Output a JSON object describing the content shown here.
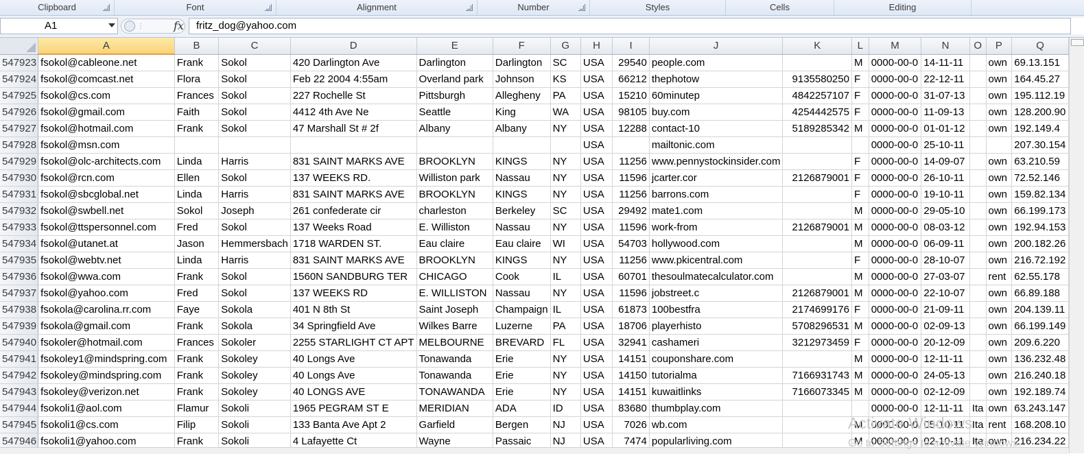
{
  "ribbon": {
    "groups": [
      "Clipboard",
      "Font",
      "Alignment",
      "Number",
      "Styles",
      "Cells",
      "Editing"
    ]
  },
  "formula_bar": {
    "name_box": "A1",
    "fx_label": "fx",
    "formula": "fritz_dog@yahoo.com"
  },
  "columns": [
    "A",
    "B",
    "C",
    "D",
    "E",
    "F",
    "G",
    "H",
    "I",
    "J",
    "K",
    "L",
    "M",
    "N",
    "O",
    "P",
    "Q"
  ],
  "selected_column": "A",
  "rows": [
    [
      "547923",
      "fsokol@cableone.net",
      "Frank",
      "Sokol",
      "420 Darlington Ave",
      "Darlington",
      "Darlington",
      "SC",
      "USA",
      "29540",
      "people.com",
      "",
      "M",
      "0000-00-0",
      "14-11-11",
      "",
      "own",
      "69.13.151"
    ],
    [
      "547924",
      "fsokol@comcast.net",
      "Flora",
      "Sokol",
      "Feb 22 2004 4:55am",
      "Overland park",
      "Johnson",
      "KS",
      "USA",
      "66212",
      "thephotow",
      "9135580250",
      "F",
      "0000-00-0",
      "22-12-11",
      "",
      "own",
      "164.45.27"
    ],
    [
      "547925",
      "fsokol@cs.com",
      "Frances",
      "Sokol",
      "227 Rochelle St",
      "Pittsburgh",
      "Allegheny",
      "PA",
      "USA",
      "15210",
      "60minutep",
      "4842257107",
      "F",
      "0000-00-0",
      "31-07-13",
      "",
      "own",
      "195.112.19"
    ],
    [
      "547926",
      "fsokol@gmail.com",
      "Faith",
      "Sokol",
      "4412 4th Ave Ne",
      "Seattle",
      "King",
      "WA",
      "USA",
      "98105",
      "buy.com",
      "4254442575",
      "F",
      "0000-00-0",
      "11-09-13",
      "",
      "own",
      "128.200.90"
    ],
    [
      "547927",
      "fsokol@hotmail.com",
      "Frank",
      "Sokol",
      "47 Marshall St # 2f",
      "Albany",
      "Albany",
      "NY",
      "USA",
      "12288",
      "contact-10",
      "5189285342",
      "M",
      "0000-00-0",
      "01-01-12",
      "",
      "own",
      "192.149.4"
    ],
    [
      "547928",
      "fsokol@msn.com",
      "",
      "",
      "",
      "",
      "",
      "",
      "USA",
      "",
      "mailtonic.com",
      "",
      "",
      "0000-00-0",
      "25-10-11",
      "",
      "",
      "207.30.154"
    ],
    [
      "547929",
      "fsokol@olc-architects.com",
      "Linda",
      "Harris",
      "831 SAINT MARKS AVE",
      "BROOKLYN",
      "KINGS",
      "NY",
      "USA",
      "11256",
      "www.pennystockinsider.com",
      "",
      "F",
      "0000-00-0",
      "14-09-07",
      "",
      "own",
      "63.210.59"
    ],
    [
      "547930",
      "fsokol@rcn.com",
      "Ellen",
      "Sokol",
      "137 WEEKS RD.",
      "Williston park",
      "Nassau",
      "NY",
      "USA",
      "11596",
      "jcarter.cor",
      "2126879001",
      "F",
      "0000-00-0",
      "26-10-11",
      "",
      "own",
      "72.52.146"
    ],
    [
      "547931",
      "fsokol@sbcglobal.net",
      "Linda",
      "Harris",
      "831 SAINT MARKS AVE",
      "BROOKLYN",
      "KINGS",
      "NY",
      "USA",
      "11256",
      "barrons.com",
      "",
      "F",
      "0000-00-0",
      "19-10-11",
      "",
      "own",
      "159.82.134"
    ],
    [
      "547932",
      "fsokol@swbell.net",
      "Sokol",
      "Joseph",
      "261 confederate cir",
      "charleston",
      "Berkeley",
      "SC",
      "USA",
      "29492",
      "mate1.com",
      "",
      "M",
      "0000-00-0",
      "29-05-10",
      "",
      "own",
      "66.199.173"
    ],
    [
      "547933",
      "fsokol@ttspersonnel.com",
      "Fred",
      "Sokol",
      "137 Weeks Road",
      "E. Williston",
      "Nassau",
      "NY",
      "USA",
      "11596",
      "work-from",
      "2126879001",
      "M",
      "0000-00-0",
      "08-03-12",
      "",
      "own",
      "192.94.153"
    ],
    [
      "547934",
      "fsokol@utanet.at",
      "Jason",
      "Hemmersbach",
      "1718 WARDEN ST.",
      "Eau claire",
      "Eau claire",
      "WI",
      "USA",
      "54703",
      "hollywood.com",
      "",
      "M",
      "0000-00-0",
      "06-09-11",
      "",
      "own",
      "200.182.26"
    ],
    [
      "547935",
      "fsokol@webtv.net",
      "Linda",
      "Harris",
      "831 SAINT MARKS AVE",
      "BROOKLYN",
      "KINGS",
      "NY",
      "USA",
      "11256",
      "www.pkicentral.com",
      "",
      "F",
      "0000-00-0",
      "28-10-07",
      "",
      "own",
      "216.72.192"
    ],
    [
      "547936",
      "fsokol@wwa.com",
      "Frank",
      "Sokol",
      "1560N SANDBURG TER",
      "CHICAGO",
      "Cook",
      "IL",
      "USA",
      "60701",
      "thesoulmatecalculator.com",
      "",
      "M",
      "0000-00-0",
      "27-03-07",
      "",
      "rent",
      "62.55.178"
    ],
    [
      "547937",
      "fsokol@yahoo.com",
      "Fred",
      "Sokol",
      "137 WEEKS RD",
      "E. WILLISTON",
      "Nassau",
      "NY",
      "USA",
      "11596",
      "jobstreet.c",
      "2126879001",
      "M",
      "0000-00-0",
      "22-10-07",
      "",
      "own",
      "66.89.188"
    ],
    [
      "547938",
      "fsokola@carolina.rr.com",
      "Faye",
      "Sokola",
      "401 N 8th St",
      "Saint Joseph",
      "Champaign",
      "IL",
      "USA",
      "61873",
      "100bestfra",
      "2174699176",
      "F",
      "0000-00-0",
      "21-09-11",
      "",
      "own",
      "204.139.11"
    ],
    [
      "547939",
      "fsokola@gmail.com",
      "Frank",
      "Sokola",
      "34 Springfield Ave",
      "Wilkes Barre",
      "Luzerne",
      "PA",
      "USA",
      "18706",
      "playerhisto",
      "5708296531",
      "M",
      "0000-00-0",
      "02-09-13",
      "",
      "own",
      "66.199.149"
    ],
    [
      "547940",
      "fsokoler@hotmail.com",
      "Frances",
      "Sokoler",
      "2255 STARLIGHT CT APT",
      "MELBOURNE",
      "BREVARD",
      "FL",
      "USA",
      "32941",
      "cashameri",
      "3212973459",
      "F",
      "0000-00-0",
      "20-12-09",
      "",
      "own",
      "209.6.220"
    ],
    [
      "547941",
      "fsokoley1@mindspring.com",
      "Frank",
      "Sokoley",
      "40 Longs Ave",
      "Tonawanda",
      "Erie",
      "NY",
      "USA",
      "14151",
      "couponshare.com",
      "",
      "M",
      "0000-00-0",
      "12-11-11",
      "",
      "own",
      "136.232.48"
    ],
    [
      "547942",
      "fsokoley@mindspring.com",
      "Frank",
      "Sokoley",
      "40 Longs Ave",
      "Tonawanda",
      "Erie",
      "NY",
      "USA",
      "14150",
      "tutorialma",
      "7166931743",
      "M",
      "0000-00-0",
      "24-05-13",
      "",
      "own",
      "216.240.18"
    ],
    [
      "547943",
      "fsokoley@verizon.net",
      "Frank",
      "Sokoley",
      "40 LONGS AVE",
      "TONAWANDA",
      "Erie",
      "NY",
      "USA",
      "14151",
      "kuwaitlinks",
      "7166073345",
      "M",
      "0000-00-0",
      "02-12-09",
      "",
      "own",
      "192.189.74"
    ],
    [
      "547944",
      "fsokoli1@aol.com",
      "Flamur",
      "Sokoli",
      "1965 PEGRAM ST E",
      "MERIDIAN",
      "ADA",
      "ID",
      "USA",
      "83680",
      "thumbplay.com",
      "",
      "",
      "0000-00-0",
      "12-11-11",
      "Ita",
      "own",
      "63.243.147"
    ],
    [
      "547945",
      "fsokoli1@cs.com",
      "Filip",
      "Sokoli",
      "133 Banta Ave Apt 2",
      "Garfield",
      "Bergen",
      "NJ",
      "USA",
      "7026",
      "wb.com",
      "",
      "M",
      "0000-00-0",
      "05-10-11",
      "Ita",
      "rent",
      "168.208.10"
    ],
    [
      "547946",
      "fsokoli1@yahoo.com",
      "Frank",
      "Sokoli",
      "4 Lafayette Ct",
      "Wayne",
      "Passaic",
      "NJ",
      "USA",
      "7474",
      "popularliving.com",
      "",
      "M",
      "0000-00-0",
      "02-10-11",
      "Ita",
      "own",
      "216.234.22"
    ]
  ],
  "watermark": {
    "line1": "Activate Windows",
    "line2": "Go to Settings to activate Windows."
  }
}
